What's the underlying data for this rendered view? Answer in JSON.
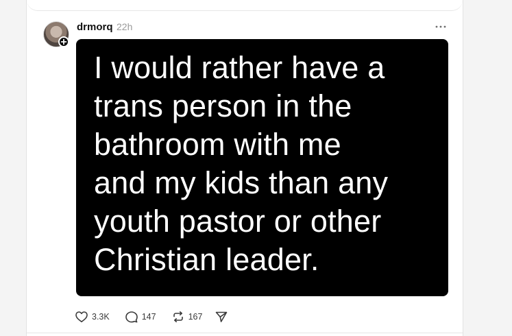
{
  "post": {
    "username": "drmorq",
    "timestamp": "22h",
    "quote_text": "I would rather have a\ntrans person in the\nbathroom with me\nand my kids than any\nyouth pastor or other\nChristian leader.",
    "actions": {
      "likes": "3.3K",
      "replies": "147",
      "reposts": "167"
    },
    "icons": {
      "follow": "plus-icon",
      "more": "more-dots-icon",
      "like": "heart-icon",
      "reply": "comment-bubble-icon",
      "repost": "repost-icon",
      "share": "send-icon"
    }
  },
  "colors": {
    "media_background": "#000000",
    "quote_text": "#ffffff",
    "timestamp": "#9a9a9a",
    "action_text": "#3a3a3a"
  }
}
